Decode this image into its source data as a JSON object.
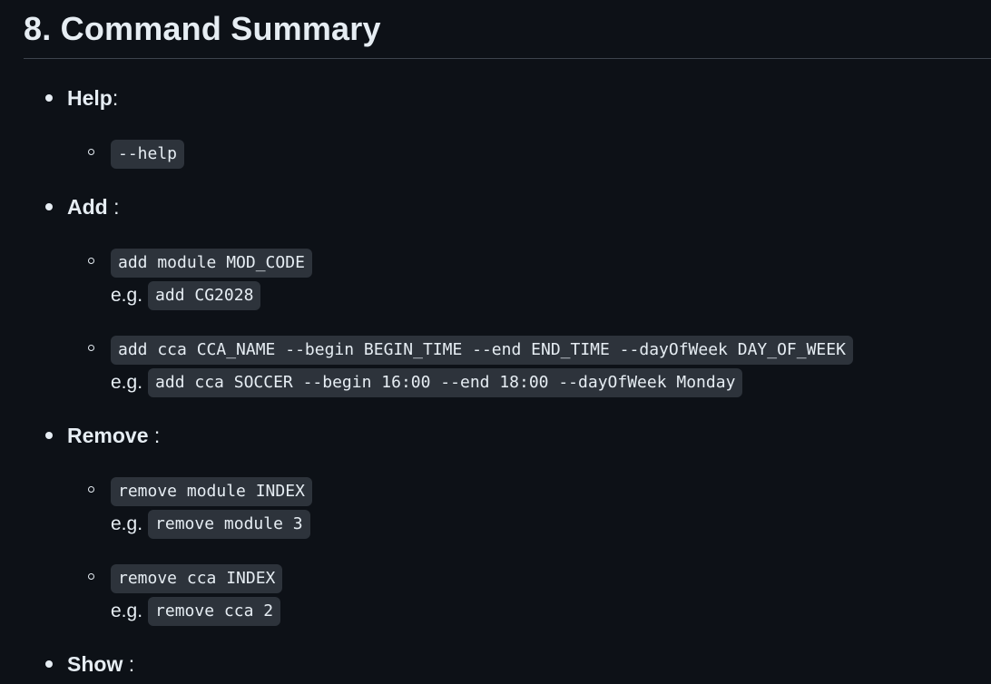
{
  "heading": "8. Command Summary",
  "sections": {
    "help": {
      "title": "Help",
      "suffix": ":",
      "items": [
        {
          "command": "--help"
        }
      ]
    },
    "add": {
      "title": "Add",
      "suffix": " :",
      "items": [
        {
          "command": "add module MOD_CODE",
          "eg_label": "e.g.",
          "example": "add CG2028"
        },
        {
          "command": "add cca CCA_NAME --begin BEGIN_TIME --end END_TIME --dayOfWeek DAY_OF_WEEK",
          "eg_label": "e.g.",
          "example": "add cca SOCCER --begin 16:00 --end 18:00 --dayOfWeek Monday"
        }
      ]
    },
    "remove": {
      "title": "Remove",
      "suffix": " :",
      "items": [
        {
          "command": "remove module INDEX",
          "eg_label": "e.g.",
          "example": "remove module 3"
        },
        {
          "command": "remove cca INDEX",
          "eg_label": "e.g.",
          "example": "remove cca 2"
        }
      ]
    },
    "show": {
      "title": "Show",
      "suffix": " :"
    }
  }
}
